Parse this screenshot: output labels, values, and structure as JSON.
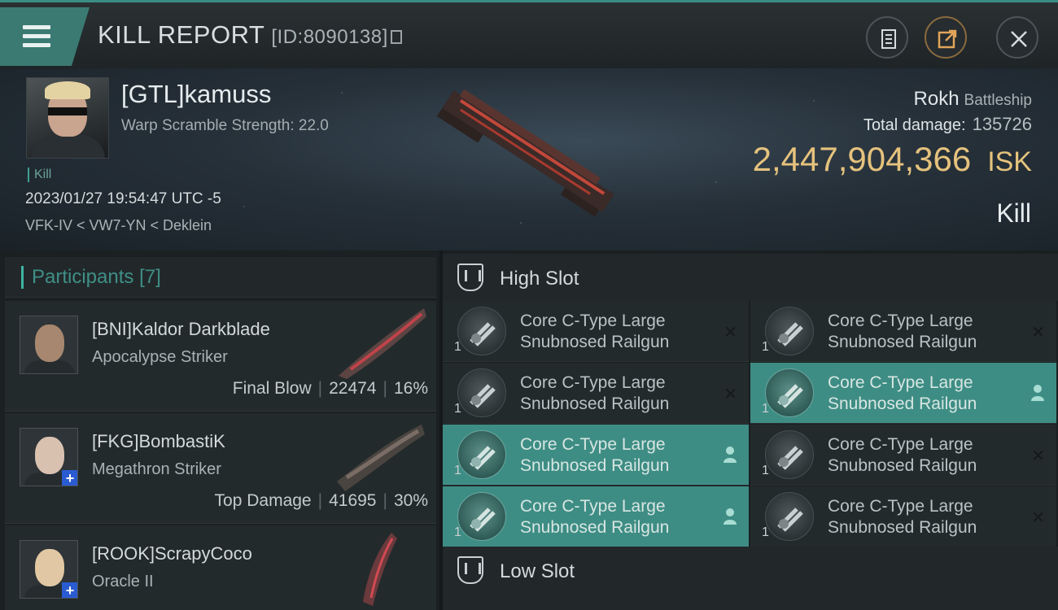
{
  "header": {
    "title": "KILL REPORT",
    "report_id": "[ID:8090138]"
  },
  "victim": {
    "name": "[GTL]kamuss",
    "warp_scramble": "Warp Scramble Strength: 22.0",
    "tag": "Kill",
    "datetime": "2023/01/27 19:54:47 UTC -5",
    "location": "VFK-IV < VW7-YN < Deklein",
    "ship": "Rokh",
    "ship_class": "Battleship",
    "total_damage_label": "Total damage:",
    "total_damage": "135726",
    "isk_value": "2,447,904,366",
    "isk_unit": "ISK",
    "result": "Kill"
  },
  "participants": {
    "label": "Participants",
    "count": "[7]",
    "items": [
      {
        "name": "[BNI]Kaldor Darkblade",
        "ship": "Apocalypse Striker",
        "stat_label": "Final Blow",
        "damage": "22474",
        "percent": "16%"
      },
      {
        "name": "[FKG]BombastiK",
        "ship": "Megathron Striker",
        "stat_label": "Top Damage",
        "damage": "41695",
        "percent": "30%"
      },
      {
        "name": "[ROOK]ScrapyCoco",
        "ship": "Oracle II",
        "stat_label": "",
        "damage": "",
        "percent": ""
      }
    ]
  },
  "slots": {
    "high_label": "High Slot",
    "low_label": "Low Slot",
    "modules": [
      {
        "line1": "Core C-Type Large",
        "line2": "Snubnosed Railgun",
        "qty": "1",
        "status": "destroyed"
      },
      {
        "line1": "Core C-Type Large",
        "line2": "Snubnosed Railgun",
        "qty": "1",
        "status": "destroyed"
      },
      {
        "line1": "Core C-Type Large",
        "line2": "Snubnosed Railgun",
        "qty": "1",
        "status": "destroyed"
      },
      {
        "line1": "Core C-Type Large",
        "line2": "Snubnosed Railgun",
        "qty": "1",
        "status": "dropped"
      },
      {
        "line1": "Core C-Type Large",
        "line2": "Snubnosed Railgun",
        "qty": "1",
        "status": "dropped"
      },
      {
        "line1": "Core C-Type Large",
        "line2": "Snubnosed Railgun",
        "qty": "1",
        "status": "destroyed"
      },
      {
        "line1": "Core C-Type Large",
        "line2": "Snubnosed Railgun",
        "qty": "1",
        "status": "dropped"
      },
      {
        "line1": "Core C-Type Large",
        "line2": "Snubnosed Railgun",
        "qty": "1",
        "status": "destroyed"
      }
    ]
  },
  "colors": {
    "accent": "#3e8d84",
    "isk_gold": "#e5c27d"
  },
  "icons": {
    "destroyed": "x-icon",
    "dropped": "person-icon"
  }
}
